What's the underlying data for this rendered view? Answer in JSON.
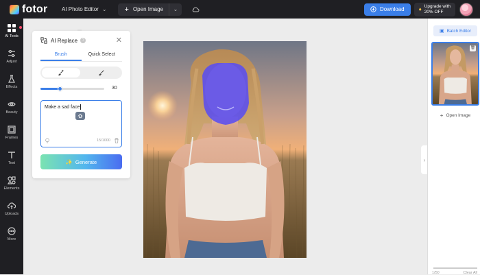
{
  "header": {
    "logo_text": "fotor",
    "editor_label": "AI Photo Editor",
    "open_image_label": "Open Image",
    "download_label": "Download",
    "upgrade_line1": "Upgrade with",
    "upgrade_line2": "20% OFF"
  },
  "sidebar": {
    "items": [
      {
        "label": "AI Tools",
        "icon": "grid-icon"
      },
      {
        "label": "Adjust",
        "icon": "sliders-icon"
      },
      {
        "label": "Effects",
        "icon": "flask-icon"
      },
      {
        "label": "Beauty",
        "icon": "eye-icon"
      },
      {
        "label": "Frames",
        "icon": "frame-icon"
      },
      {
        "label": "Text",
        "icon": "text-icon"
      },
      {
        "label": "Elements",
        "icon": "shapes-icon"
      },
      {
        "label": "Uploads",
        "icon": "cloud-upload-icon"
      },
      {
        "label": "More",
        "icon": "more-icon"
      }
    ]
  },
  "panel": {
    "title": "AI Replace",
    "tabs": [
      "Brush",
      "Quick Select"
    ],
    "active_tab": "Brush",
    "brush_size": "30",
    "brush_size_fraction": 0.31,
    "prompt_value": "Make a sad face",
    "char_count": "15/1000",
    "generate_label": "Generate"
  },
  "right_panel": {
    "batch_editor_label": "Batch Editor",
    "open_image_label": "Open Image",
    "footer_left": "1/50",
    "footer_right": "Clear All"
  },
  "colors": {
    "accent": "#3a7ee8",
    "dark_bg": "#1f1f23",
    "mask": "#5a4df0"
  }
}
